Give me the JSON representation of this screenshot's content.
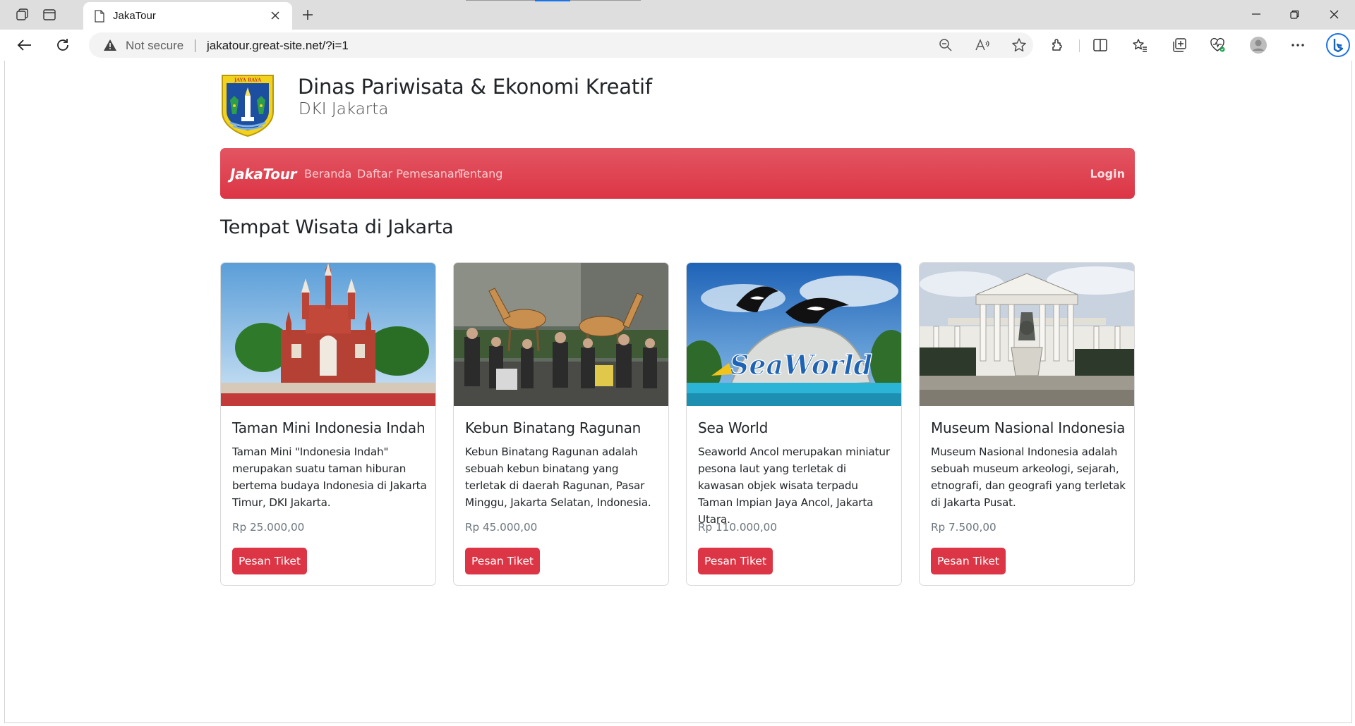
{
  "browser": {
    "tab_title": "JakaTour",
    "not_secure": "Not secure",
    "url": "jakatour.great-site.net/?i=1"
  },
  "header": {
    "title": "Dinas Pariwisata & Ekonomi Kreatif",
    "subtitle": "DKI Jakarta",
    "logo_text": "JAYA RAYA"
  },
  "navbar": {
    "brand": "JakaTour",
    "links": [
      "Beranda",
      "Daftar Pemesanan",
      "Tentang"
    ],
    "login": "Login",
    "color": "#dc3545"
  },
  "main": {
    "section_title": "Tempat Wisata di Jakarta",
    "cards": [
      {
        "title": "Taman Mini Indonesia Indah",
        "description": "Taman Mini \"Indonesia Indah\" merupakan suatu taman hiburan bertema budaya Indonesia di Jakarta Timur, DKI Jakarta.",
        "price": "Rp 25.000,00",
        "button": "Pesan Tiket"
      },
      {
        "title": "Kebun Binatang Ragunan",
        "description": "Kebun Binatang Ragunan adalah sebuah kebun binatang yang terletak di daerah Ragunan, Pasar Minggu, Jakarta Selatan, Indonesia.",
        "price": "Rp 45.000,00",
        "button": "Pesan Tiket"
      },
      {
        "title": "Sea World",
        "description": "Seaworld Ancol merupakan miniatur pesona laut yang terletak di kawasan objek wisata terpadu Taman Impian Jaya Ancol, Jakarta Utara.",
        "price": "Rp 110.000,00",
        "button": "Pesan Tiket",
        "image_text": "SeaWorld"
      },
      {
        "title": "Museum Nasional Indonesia",
        "description": "Museum Nasional Indonesia adalah sebuah museum arkeologi, sejarah, etnografi, dan geografi yang terletak di Jakarta Pusat.",
        "price": "Rp 7.500,00",
        "button": "Pesan Tiket"
      }
    ]
  }
}
